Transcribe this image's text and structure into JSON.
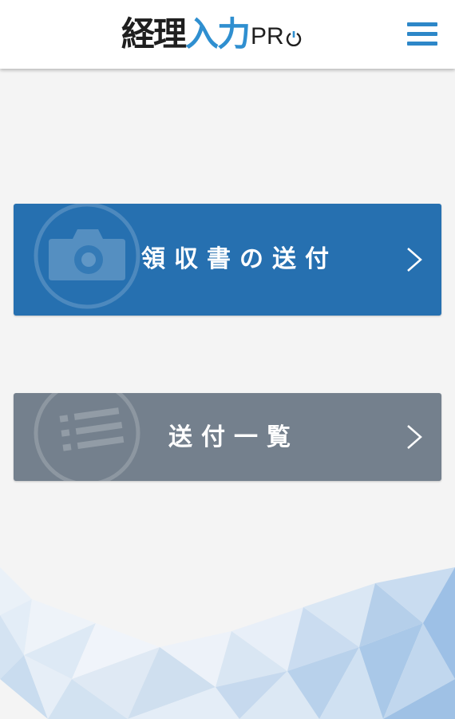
{
  "header": {
    "logo": {
      "kanji_dark": "経理",
      "kanji_blue": "入力",
      "pro": "PR",
      "icon": "power-icon"
    },
    "menu_icon": "hamburger-menu-icon"
  },
  "buttons": {
    "send_receipt": {
      "label": "領収書の送付",
      "icon": "camera-icon",
      "chevron": "chevron-right-icon",
      "color": "#2670b0"
    },
    "sent_list": {
      "label": "送付一覧",
      "icon": "list-icon",
      "chevron": "chevron-right-icon",
      "color": "#74808d"
    }
  },
  "colors": {
    "accent": "#2d87c8",
    "background": "#f4f4f4"
  }
}
